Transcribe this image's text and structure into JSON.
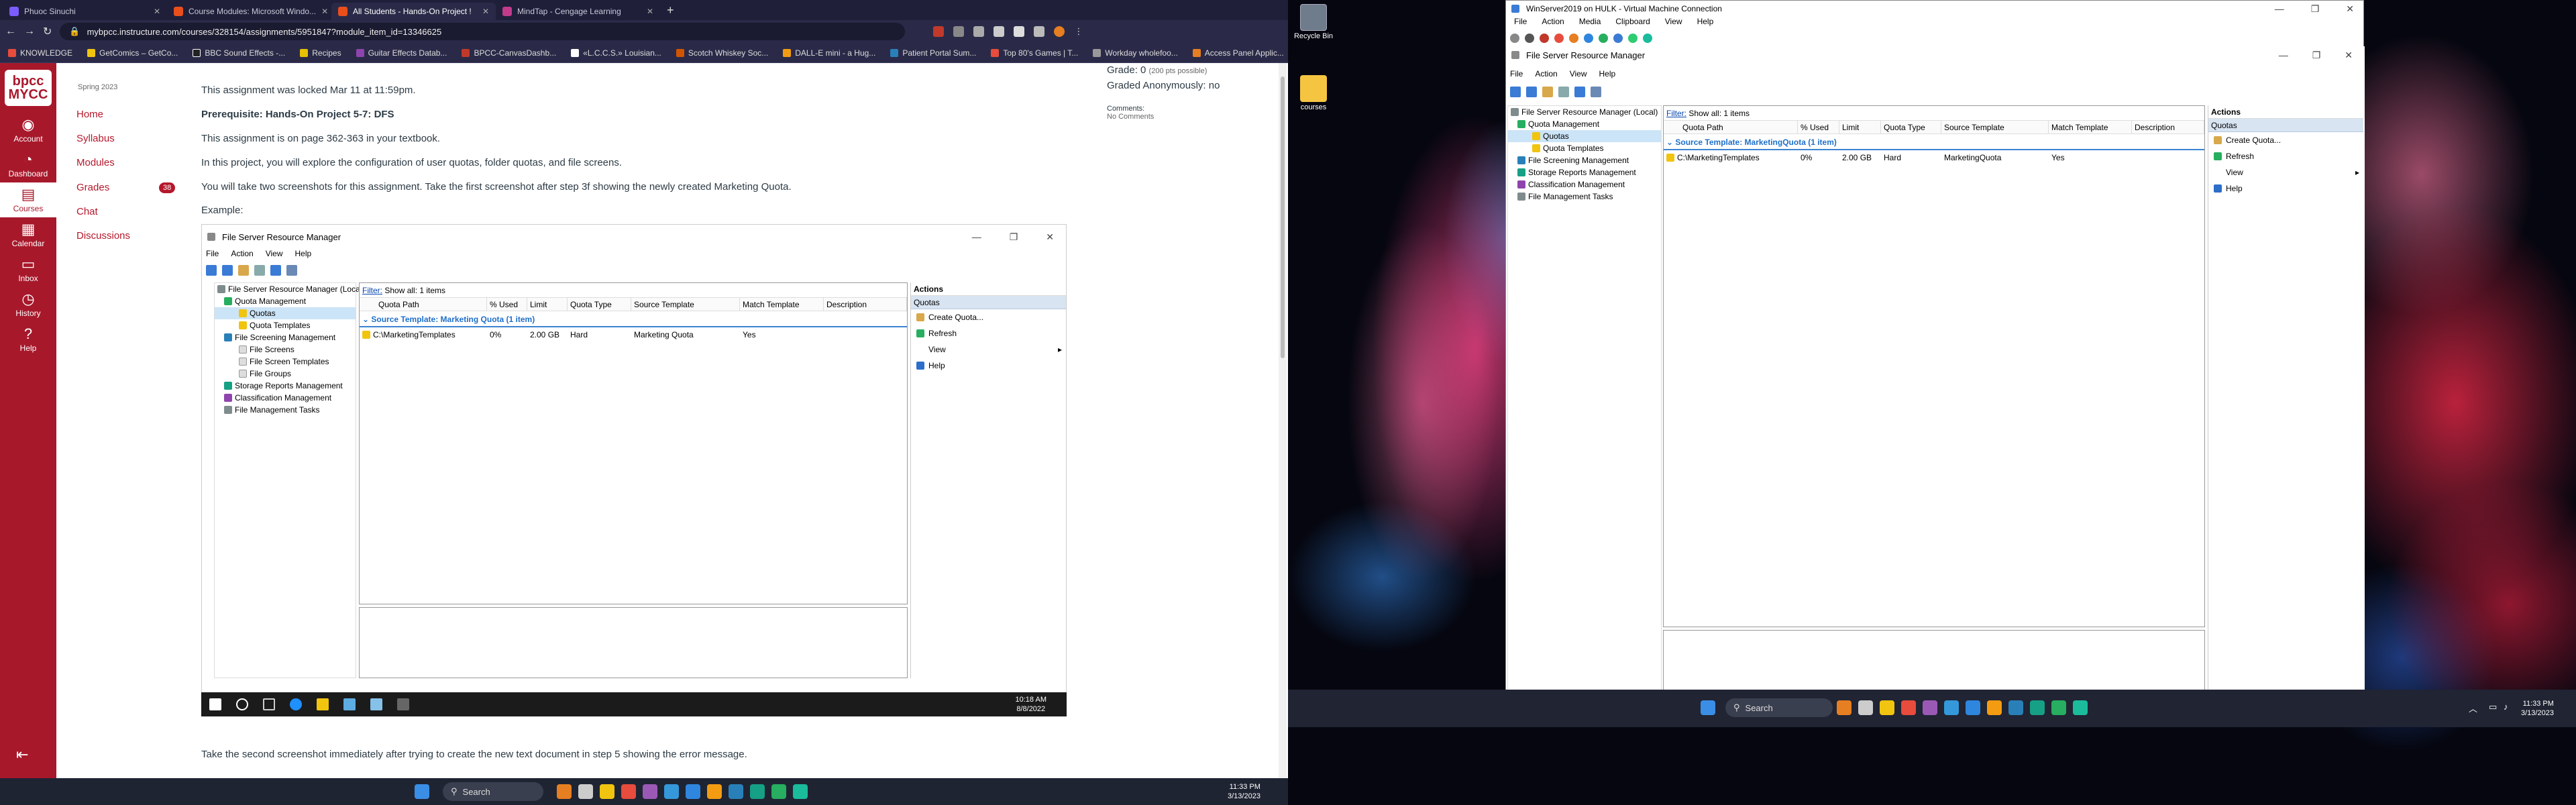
{
  "browser": {
    "tabs": [
      {
        "label": "Phuoc Sinuchi",
        "active": false
      },
      {
        "label": "Course Modules: Microsoft Windo...",
        "active": false
      },
      {
        "label": "All Students - Hands-On Project !",
        "active": true
      },
      {
        "label": "MindTap - Cengage Learning",
        "active": false
      }
    ],
    "new_tab": "+",
    "url": "mybpcc.instructure.com/courses/328154/assignments/5951847?module_item_id=13346625",
    "bookmarks": [
      "KNOWLEDGE",
      "GetComics – GetCo...",
      "BBC Sound Effects -...",
      "Recipes",
      "Guitar Effects Datab...",
      "BPCC-CanvasDashb...",
      "«L.C.C.S.» Louisian...",
      "Scotch Whiskey Soc...",
      "DALL-E mini - a Hug...",
      "Patient Portal Sum...",
      "Top 80's Games | T...",
      "Workday wholefoo...",
      "Access Panel Applic..."
    ]
  },
  "global_nav": {
    "logo": "bpcc MYCC",
    "items": [
      {
        "label": "Account",
        "icon": "account-icon"
      },
      {
        "label": "Dashboard",
        "icon": "dashboard-icon"
      },
      {
        "label": "Courses",
        "icon": "courses-icon",
        "active": true
      },
      {
        "label": "Calendar",
        "icon": "calendar-icon"
      },
      {
        "label": "Inbox",
        "icon": "inbox-icon"
      },
      {
        "label": "History",
        "icon": "history-icon"
      },
      {
        "label": "Help",
        "icon": "help-icon"
      }
    ]
  },
  "course_nav": {
    "term": "Spring 2023",
    "links": [
      "Home",
      "Syllabus",
      "Modules",
      "Grades",
      "Chat",
      "Discussions"
    ],
    "grades_badge": "38"
  },
  "assignment": {
    "locked": "This assignment was locked Mar 11 at 11:59pm.",
    "prereq": "Prerequisite: Hands-On Project 5-7: DFS",
    "page": "This assignment is on page 362-363 in your textbook.",
    "intro": "In this project, you will explore the configuration of user quotas, folder quotas, and file screens.",
    "screens": "You will take two screenshots for this assignment. Take the first screenshot after step 3f showing the newly created Marketing Quota.",
    "example": "Example:",
    "second": "Take the second screenshot immediately after trying to create the new text document in step 5 showing the error message.",
    "grade": "Grade: 0",
    "grade_possible": "(200 pts possible)",
    "graded_anon": "Graded Anonymously: no",
    "comments": "Comments:",
    "no_comments": "No Comments"
  },
  "example_fsrm": {
    "title": "File Server Resource Manager",
    "menu": [
      "File",
      "Action",
      "View",
      "Help"
    ],
    "tree": [
      {
        "label": "File Server Resource Manager (Local)",
        "indent": 0
      },
      {
        "label": "Quota Management",
        "indent": 1
      },
      {
        "label": "Quotas",
        "indent": 2,
        "selected": true
      },
      {
        "label": "Quota Templates",
        "indent": 2
      },
      {
        "label": "File Screening Management",
        "indent": 1
      },
      {
        "label": "File Screens",
        "indent": 2
      },
      {
        "label": "File Screen Templates",
        "indent": 2
      },
      {
        "label": "File Groups",
        "indent": 2
      },
      {
        "label": "Storage Reports Management",
        "indent": 1
      },
      {
        "label": "Classification Management",
        "indent": 1
      },
      {
        "label": "File Management Tasks",
        "indent": 1
      }
    ],
    "filter_label": "Filter:",
    "filter_text": "Show all: 1 items",
    "columns": [
      "Quota Path",
      "% Used",
      "Limit",
      "Quota Type",
      "Source Template",
      "Match Template",
      "Description"
    ],
    "group": "Source Template: Marketing Quota (1 item)",
    "row": [
      "C:\\MarketingTemplates",
      "0%",
      "2.00 GB",
      "Hard",
      "Marketing Quota",
      "Yes",
      ""
    ],
    "actions_header": "Actions",
    "actions_section": "Quotas",
    "actions": [
      "Create Quota...",
      "Refresh",
      "View",
      "Help"
    ],
    "taskbar_time": "10:18 AM",
    "taskbar_date": "8/8/2022"
  },
  "left_taskbar": {
    "search": "Search",
    "time": "11:33 PM",
    "date": "3/13/2023"
  },
  "desktop": {
    "icons": [
      "Recycle Bin",
      "courses"
    ]
  },
  "vm": {
    "title": "WinServer2019 on HULK - Virtual Machine Connection",
    "menu": [
      "File",
      "Action",
      "Media",
      "Clipboard",
      "View",
      "Help"
    ],
    "fsrm": {
      "title": "File Server Resource Manager",
      "menu": [
        "File",
        "Action",
        "View",
        "Help"
      ],
      "tree": [
        {
          "label": "File Server Resource Manager (Local)",
          "indent": 0
        },
        {
          "label": "Quota Management",
          "indent": 1
        },
        {
          "label": "Quotas",
          "indent": 2,
          "selected": true
        },
        {
          "label": "Quota Templates",
          "indent": 2
        },
        {
          "label": "File Screening Management",
          "indent": 1
        },
        {
          "label": "Storage Reports Management",
          "indent": 1
        },
        {
          "label": "Classification Management",
          "indent": 1
        },
        {
          "label": "File Management Tasks",
          "indent": 1
        }
      ],
      "filter_label": "Filter:",
      "filter_text": "Show all: 1 items",
      "columns": [
        "Quota Path",
        "% Used",
        "Limit",
        "Quota Type",
        "Source Template",
        "Match Template",
        "Description"
      ],
      "group": "Source Template: MarketingQuota (1 item)",
      "row": [
        "C:\\MarketingTemplates",
        "0%",
        "2.00 GB",
        "Hard",
        "MarketingQuota",
        "Yes",
        ""
      ],
      "actions_header": "Actions",
      "actions_section": "Quotas",
      "actions": [
        "Create Quota...",
        "Refresh",
        "View",
        "Help"
      ]
    }
  },
  "right_taskbar": {
    "search": "Search",
    "time": "11:33 PM",
    "date": "3/13/2023"
  },
  "colors": {
    "canvas_red": "#a8182b",
    "link_red": "#b5182b",
    "fsrm_blue": "#1f6fc9"
  }
}
